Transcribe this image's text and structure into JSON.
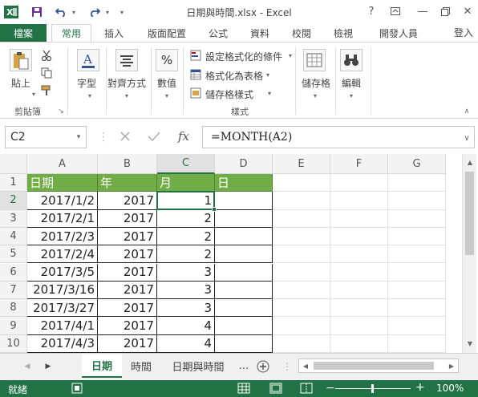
{
  "window": {
    "title": "日期與時間.xlsx - Excel",
    "help_label": "?",
    "minimize_label": "—",
    "close_label": "✕"
  },
  "ribbon_tabs": {
    "file": "檔案",
    "items": [
      "常用",
      "插入",
      "版面配置",
      "公式",
      "資料",
      "校閱",
      "檢視",
      "開發人員"
    ],
    "active_index": 0,
    "login": "登入"
  },
  "ribbon": {
    "paste_label": "貼上",
    "clipboard_group": "剪貼簿",
    "font_label": "字型",
    "alignment_label": "對齊方式",
    "number_label": "數值",
    "percent_symbol": "%",
    "conditional_format": "設定格式化的條件",
    "format_as_table": "格式化為表格",
    "cell_styles": "儲存格樣式",
    "styles_group": "樣式",
    "cells_label": "儲存格",
    "editing_label": "編輯"
  },
  "formula_bar": {
    "name_box": "C2",
    "fx_label": "fx",
    "formula": "=MONTH(A2)"
  },
  "sheet": {
    "columns": [
      "A",
      "B",
      "C",
      "D",
      "E",
      "F",
      "G"
    ],
    "selected_column": "C",
    "selected_row": 2,
    "rows": [
      {
        "num": "1",
        "cells": [
          "日期",
          "年",
          "月",
          "日"
        ]
      },
      {
        "num": "2",
        "cells": [
          "2017/1/2",
          "2017",
          "1",
          ""
        ]
      },
      {
        "num": "3",
        "cells": [
          "2017/2/1",
          "2017",
          "2",
          ""
        ]
      },
      {
        "num": "4",
        "cells": [
          "2017/2/3",
          "2017",
          "2",
          ""
        ]
      },
      {
        "num": "5",
        "cells": [
          "2017/2/4",
          "2017",
          "2",
          ""
        ]
      },
      {
        "num": "6",
        "cells": [
          "2017/3/5",
          "2017",
          "3",
          ""
        ]
      },
      {
        "num": "7",
        "cells": [
          "2017/3/16",
          "2017",
          "3",
          ""
        ]
      },
      {
        "num": "8",
        "cells": [
          "2017/3/27",
          "2017",
          "3",
          ""
        ]
      },
      {
        "num": "9",
        "cells": [
          "2017/4/1",
          "2017",
          "4",
          ""
        ]
      },
      {
        "num": "10",
        "cells": [
          "2017/4/3",
          "2017",
          "4",
          ""
        ]
      }
    ]
  },
  "sheet_tabs": {
    "tabs": [
      "日期",
      "時間",
      "日期與時間"
    ],
    "active_index": 0,
    "more_label": "..."
  },
  "status_bar": {
    "status": "就緒",
    "zoom": "100%",
    "zoom_minus": "−",
    "zoom_plus": "+"
  },
  "colors": {
    "accent": "#217346",
    "header_fill": "#70ad47"
  }
}
